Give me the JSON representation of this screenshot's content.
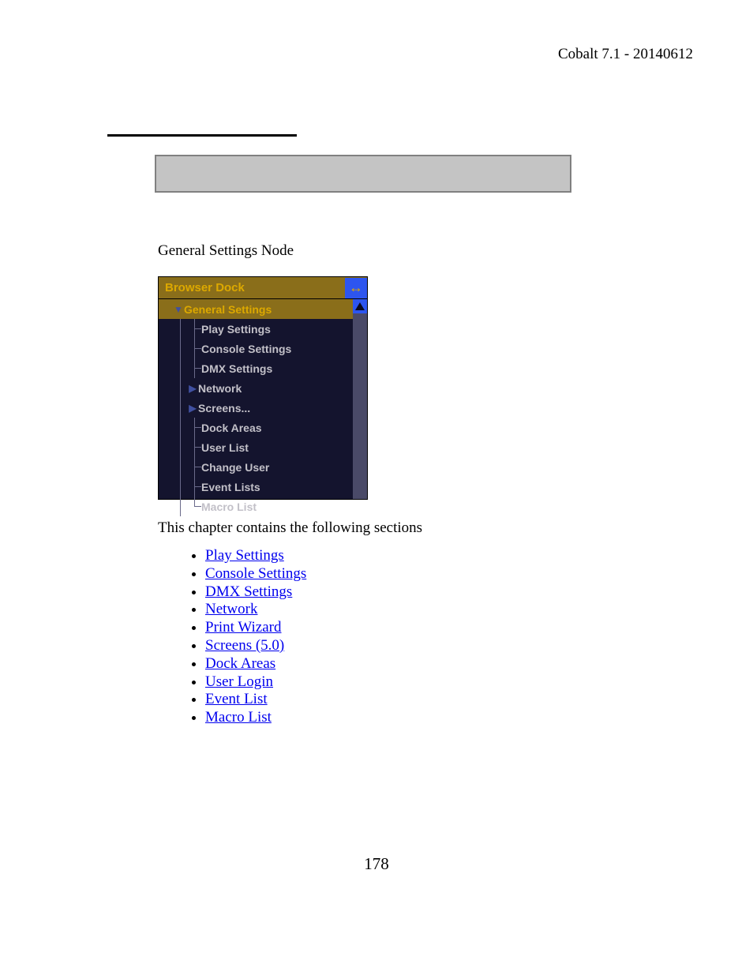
{
  "header": "Cobalt 7.1 - 20140612",
  "section_label": "General Settings Node",
  "dock": {
    "title": "Browser Dock",
    "root": "General Settings",
    "items": [
      {
        "label": "Play Settings",
        "expandable": false
      },
      {
        "label": "Console Settings",
        "expandable": false
      },
      {
        "label": "DMX Settings",
        "expandable": false
      },
      {
        "label": "Network",
        "expandable": true
      },
      {
        "label": "Screens...",
        "expandable": true
      },
      {
        "label": "Dock Areas",
        "expandable": false
      },
      {
        "label": "User List",
        "expandable": false
      },
      {
        "label": "Change User",
        "expandable": false
      },
      {
        "label": "Event Lists",
        "expandable": false
      },
      {
        "label": "Macro List",
        "expandable": false
      }
    ]
  },
  "chapter_text": "This chapter contains the following sections",
  "links": [
    "Play Settings",
    "Console Settings",
    "DMX Settings",
    "Network",
    "Print Wizard",
    "Screens (5.0)",
    "Dock Areas",
    "User Login",
    "Event List",
    "Macro List"
  ],
  "page_number": "178"
}
